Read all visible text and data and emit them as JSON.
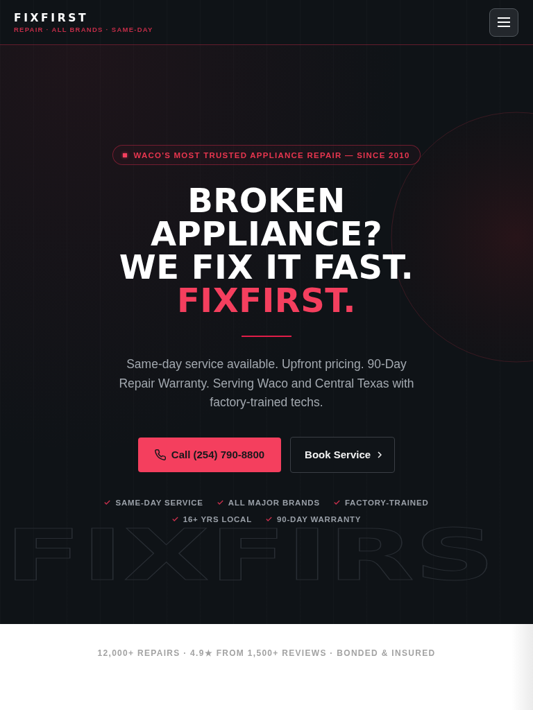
{
  "header": {
    "logo": "FIXFIRST",
    "tagline": "REPAIR · ALL BRANDS · SAME-DAY"
  },
  "hero": {
    "badge": "WACO'S MOST TRUSTED APPLIANCE REPAIR — SINCE 2010",
    "headline_lines": [
      {
        "text": "BROKEN",
        "accent": false
      },
      {
        "text": "APPLIANCE?",
        "accent": false
      },
      {
        "text": "WE FIX IT FAST.",
        "accent": false
      },
      {
        "text": "FIXFIRST.",
        "accent": true
      }
    ],
    "description": "Same-day service available. Upfront pricing. 90-Day Repair Warranty. Serving Waco and Central Texas with factory-trained techs.",
    "buttons": [
      {
        "kind": "primary",
        "label": "Call (254) 790-8800"
      },
      {
        "kind": "secondary",
        "label": "Book Service"
      }
    ],
    "features": [
      "SAME-DAY SERVICE",
      "ALL MAJOR BRANDS",
      "FACTORY-TRAINED",
      "16+ YRS LOCAL",
      "90-DAY WARRANTY"
    ],
    "background_wordmark": "FIXFIRS"
  },
  "stats_bar": {
    "text": "12,000+ REPAIRS · 4.9★ FROM 1,500+ REVIEWS · BONDED & INSURED"
  }
}
